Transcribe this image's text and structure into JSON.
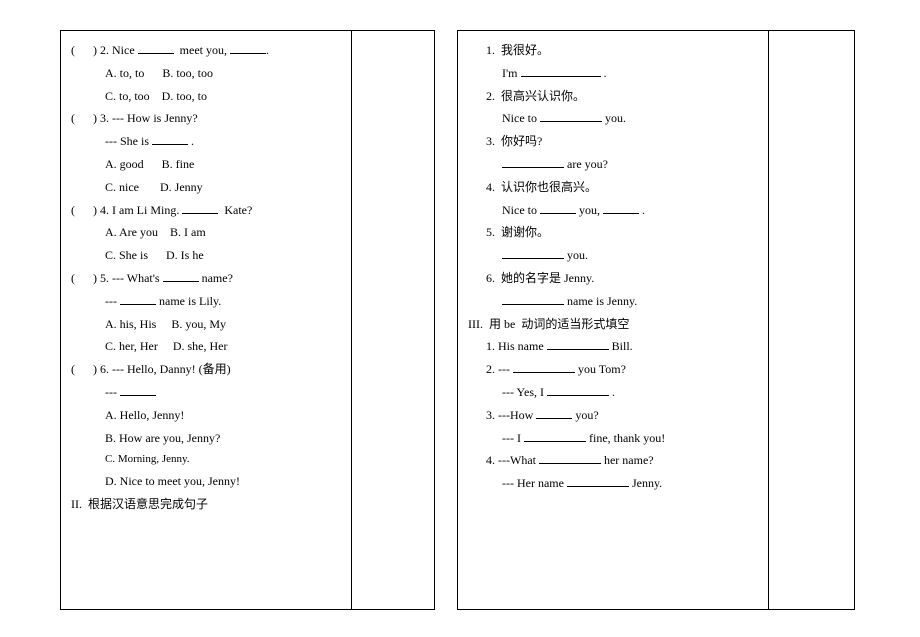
{
  "left": {
    "q2": {
      "stem_prefix": "(      ) 2. Nice ",
      "stem_mid": "  meet you, ",
      "stem_suffix": ".",
      "optA": "A. to, to",
      "optB": "B. too, too",
      "optC": "C. to, too",
      "optD": "D. too, to"
    },
    "q3": {
      "stem": "(      ) 3. --- How is Jenny?",
      "resp_prefix": "--- She is ",
      "resp_suffix": " .",
      "optA": "A. good",
      "optB": "B. fine",
      "optC": "C. nice",
      "optD": "D. Jenny"
    },
    "q4": {
      "stem_prefix": "(      ) 4. I am Li Ming. ",
      "stem_suffix": "  Kate?",
      "optA": "A. Are you",
      "optB": "B. I am",
      "optC": "C. She is",
      "optD": "D. Is he"
    },
    "q5": {
      "stem_prefix": "(      ) 5. --- What's ",
      "stem_suffix": " name?",
      "resp_prefix": "--- ",
      "resp_suffix": " name is Lily.",
      "optA": "A. his, His",
      "optB": "B. you, My",
      "optC": "C. her, Her",
      "optD": "D. she, Her"
    },
    "q6": {
      "stem": "(      ) 6. --- Hello, Danny! (备用)",
      "resp": "--- ",
      "optA": "A. Hello, Jenny!",
      "optB": "B. How are you, Jenny?",
      "optC": "C. Morning, Jenny.",
      "optD": "D. Nice to meet you, Jenny!"
    },
    "sectionII": "II.  根据汉语意思完成句子"
  },
  "right": {
    "s1": {
      "zh": "1.  我很好。",
      "en_prefix": "I'm ",
      "en_suffix": " ."
    },
    "s2": {
      "zh": "2.  很高兴认识你。",
      "en_prefix": "Nice to ",
      "en_suffix": " you."
    },
    "s3": {
      "zh": "3.  你好吗?",
      "en_suffix": " are you?"
    },
    "s4": {
      "zh": "4.  认识你也很高兴。",
      "en_prefix": "Nice to ",
      "en_mid": " you, ",
      "en_suffix": " ."
    },
    "s5": {
      "zh": "5.  谢谢你。",
      "en_suffix": " you."
    },
    "s6": {
      "zh": "6.  她的名字是 Jenny.",
      "en_suffix": " name is Jenny."
    },
    "sectionIII": "III.  用 be  动词的适当形式填空",
    "b1": {
      "prefix": "1. His name ",
      "suffix": " Bill."
    },
    "b2": {
      "q_prefix": "2. --- ",
      "q_suffix": " you Tom?",
      "a_prefix": "--- Yes, I ",
      "a_suffix": " ."
    },
    "b3": {
      "q_prefix": "3. ---How ",
      "q_suffix": " you?",
      "a_prefix": "--- I ",
      "a_suffix": " fine, thank you!"
    },
    "b4": {
      "q_prefix": "4. ---What ",
      "q_suffix": " her name?",
      "a_prefix": "--- Her name ",
      "a_suffix": " Jenny."
    }
  }
}
